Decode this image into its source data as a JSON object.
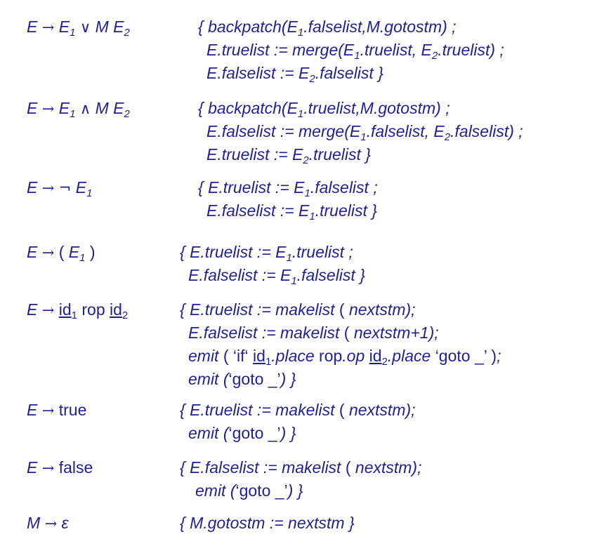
{
  "rules": [
    {
      "production": "E → E1 ∨ M E2",
      "action_lines": [
        "{ backpatch(E1.falselist,M.gotostm) ;",
        "E.truelist := merge(E1.truelist, E2.truelist) ;",
        "E.falselist := E2.falselist }"
      ]
    },
    {
      "production": "E → E1 ∧ M E2",
      "action_lines": [
        "{ backpatch(E1.truelist,M.gotostm) ;",
        "E.falselist := merge(E1.falselist, E2.falselist) ;",
        "E.truelist := E2.truelist }"
      ]
    },
    {
      "production": "E → ¬ E1",
      "action_lines": [
        "{ E.truelist := E1.falselist ;",
        "E.falselist := E1.truelist }"
      ]
    },
    {
      "production": "E → ( E1 )",
      "action_lines": [
        "{ E.truelist := E1.truelist ;",
        "E.falselist := E1.falselist }"
      ]
    },
    {
      "production": "E → id1 rop id2",
      "action_lines": [
        "{ E.truelist := makelist ( nextstm);",
        "E.falselist := makelist ( nextstm+1);",
        "emit ( ‘if‘ id1.place rop.op id2.place ‘goto _’ );",
        "emit (‘goto _’) }"
      ]
    },
    {
      "production": "E → true",
      "action_lines": [
        "{ E.truelist := makelist ( nextstm);",
        "emit (‘goto _’) }"
      ]
    },
    {
      "production": "E → false",
      "action_lines": [
        "{ E.falselist := makelist ( nextstm);",
        "emit (‘goto _’) }"
      ]
    },
    {
      "production": "M → ε",
      "action_lines": [
        "{ M.gotostm := nextstm }"
      ]
    }
  ],
  "colors": {
    "text": "#1f1f96",
    "background": "#ffffff"
  }
}
